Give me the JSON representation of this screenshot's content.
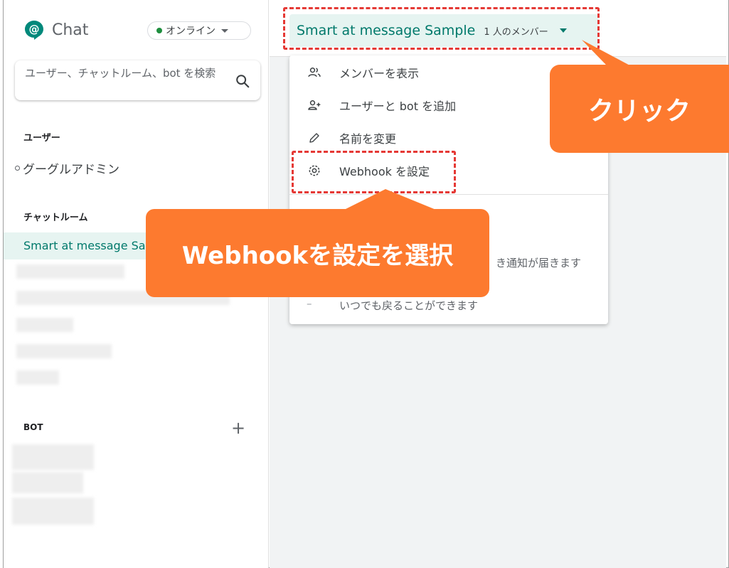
{
  "app": {
    "title": "Chat",
    "status": "オンライン"
  },
  "search": {
    "placeholder": "ユーザー、チャットルーム、bot を検索"
  },
  "sidebar": {
    "users_header": "ユーザー",
    "users": [
      "グーグルアドミン"
    ],
    "rooms_header": "チャットルーム",
    "active_room": "Smart at message Sample",
    "bot_header": "BOT"
  },
  "room": {
    "title": "Smart at message Sample",
    "members": "1 人のメンバー"
  },
  "menu": {
    "items": [
      "メンバーを表示",
      "ユーザーと bot を追加",
      "名前を変更",
      "Webhook を設定"
    ],
    "desc_line1": "き通知が届きます",
    "desc_line2": "いつでも戻ることができます"
  },
  "annotations": {
    "click_label": "クリック",
    "select_label": "Webhookを設定を選択",
    "color": "#fd7a2f",
    "dash_color": "#e53935"
  },
  "colors": {
    "accent": "#00796b",
    "active_bg": "#e6f4f1",
    "online": "#1e8e3e"
  }
}
